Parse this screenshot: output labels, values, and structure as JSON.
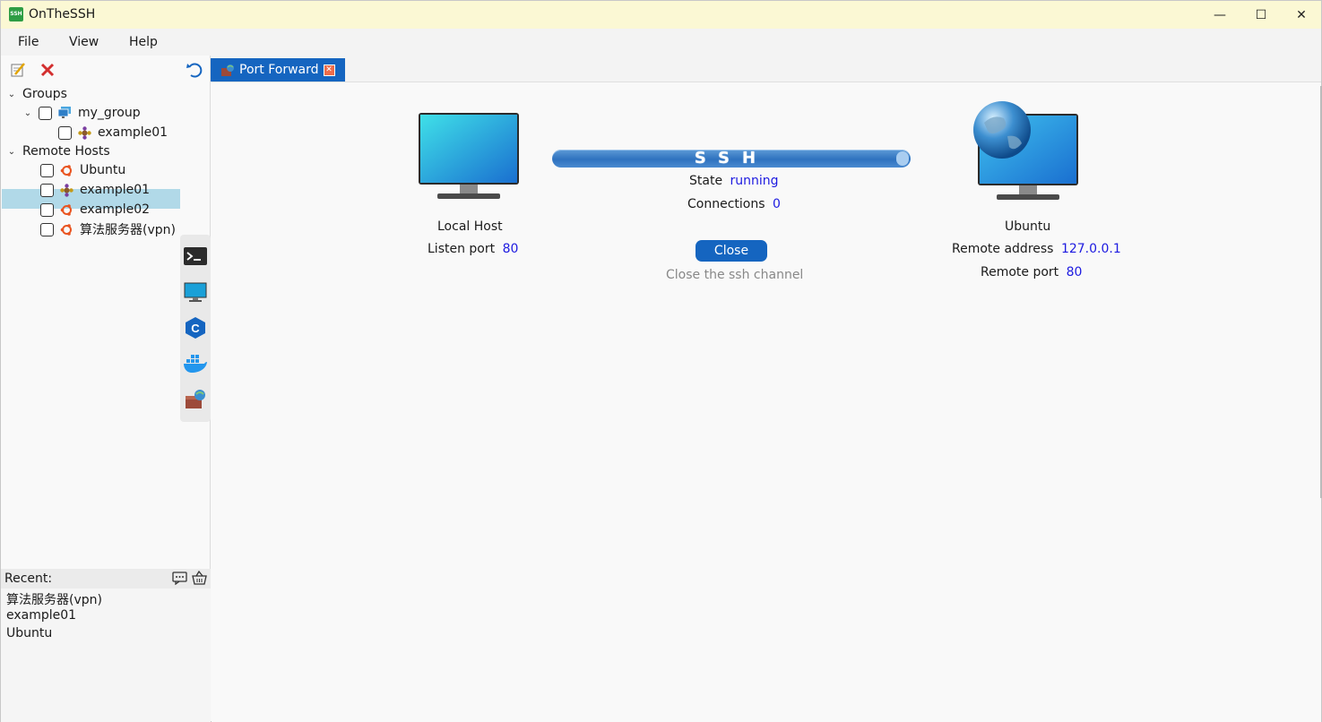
{
  "window": {
    "title": "OnTheSSH",
    "app_icon_text": "SSH",
    "controls": {
      "minimize": "—",
      "maximize": "☐",
      "close": "✕"
    }
  },
  "menu": {
    "items": [
      "File",
      "View",
      "Help"
    ]
  },
  "toolbar": {
    "icons": [
      "edit-icon",
      "delete-icon",
      "refresh-icon"
    ],
    "delete_color": "#d32f2f",
    "refresh_color": "#1565c0"
  },
  "tree": {
    "groups_label": "Groups",
    "group_name": "my_group",
    "group_child": "example01",
    "remote_hosts_label": "Remote Hosts",
    "hosts": [
      "Ubuntu",
      "example01",
      "example02",
      "算法服务器(vpn)"
    ],
    "selected_host": "Ubuntu",
    "selected_color": "#b1d9e8"
  },
  "side_tools": [
    "terminal-icon",
    "desktop-icon",
    "c-language-icon",
    "docker-icon",
    "port-forward-icon"
  ],
  "recent": {
    "label": "Recent:",
    "items": [
      "算法服务器(vpn)",
      "example01",
      "Ubuntu"
    ]
  },
  "tab": {
    "label": "Port Forward",
    "active_color": "#1565c0"
  },
  "port_forward": {
    "local": {
      "title": "Local Host",
      "listen_port_label": "Listen port",
      "listen_port": "80"
    },
    "tunnel": {
      "text": "SSH",
      "state_label": "State",
      "state": "running",
      "connections_label": "Connections",
      "connections": "0",
      "close_button": "Close",
      "close_hint": "Close the ssh channel"
    },
    "remote": {
      "title": "Ubuntu",
      "address_label": "Remote address",
      "address": "127.0.0.1",
      "port_label": "Remote port",
      "port": "80"
    },
    "value_color": "#1d1ae0"
  }
}
